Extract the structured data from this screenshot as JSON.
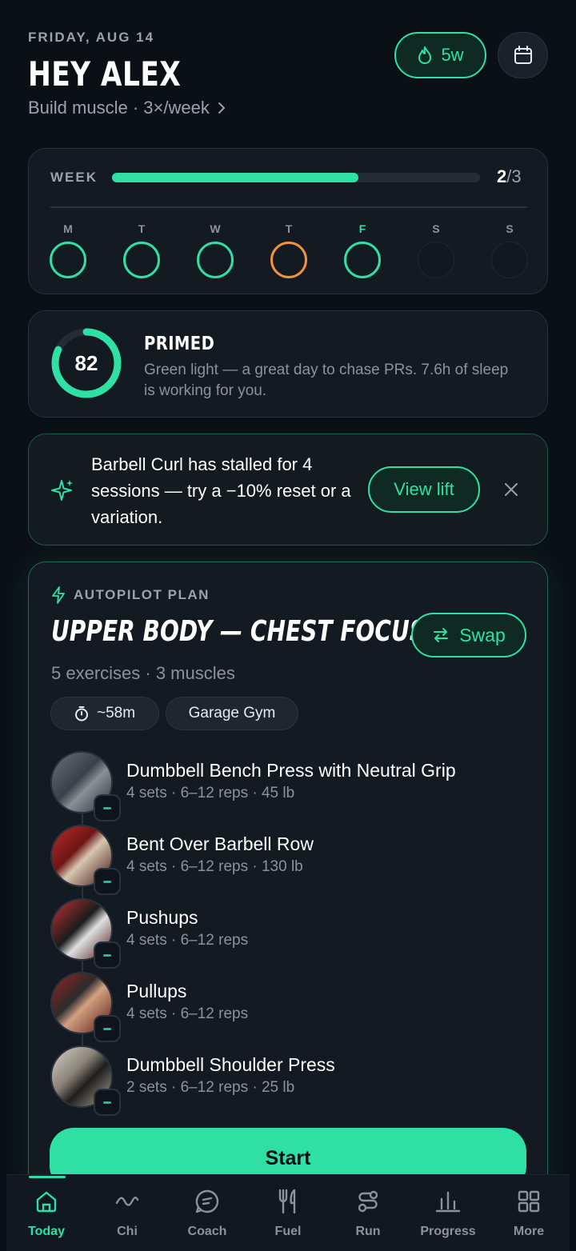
{
  "header": {
    "date": "FRIDAY, AUG 14",
    "greeting": "HEY ALEX",
    "goal": "Build muscle · 3×/week",
    "streak": "5w"
  },
  "week": {
    "label": "WEEK",
    "done": "2",
    "total": "/3",
    "progress": 0.67,
    "days": [
      {
        "letter": "M",
        "state": "done"
      },
      {
        "letter": "T",
        "state": "done"
      },
      {
        "letter": "W",
        "state": "done"
      },
      {
        "letter": "T",
        "state": "partial"
      },
      {
        "letter": "F",
        "state": "today"
      },
      {
        "letter": "S",
        "state": "empty"
      },
      {
        "letter": "S",
        "state": "empty"
      }
    ]
  },
  "readiness": {
    "score": "82",
    "score_fraction": 0.82,
    "title": "PRIMED",
    "description": "Green light — a great day to chase PRs. 7.6h of sleep is working for you."
  },
  "insight": {
    "text": "Barbell Curl has stalled for 4 sessions — try a −10% reset or a variation.",
    "button": "View lift"
  },
  "plan": {
    "label": "AUTOPILOT PLAN",
    "title": "UPPER BODY — CHEST FOCUS",
    "swap": "Swap",
    "meta": "5 exercises · 3 muscles",
    "duration": "~58m",
    "location": "Garage Gym",
    "exercises": [
      {
        "name": "Dumbbell Bench Press with Neutral Grip",
        "detail": "4 sets · 6–12 reps · 45 lb"
      },
      {
        "name": "Bent Over Barbell Row",
        "detail": "4 sets · 6–12 reps · 130 lb"
      },
      {
        "name": "Pushups",
        "detail": "4 sets · 6–12 reps"
      },
      {
        "name": "Pullups",
        "detail": "4 sets · 6–12 reps"
      },
      {
        "name": "Dumbbell Shoulder Press",
        "detail": "2 sets · 6–12 reps · 25 lb"
      }
    ],
    "start": "Start"
  },
  "nav": {
    "items": [
      {
        "label": "Today",
        "icon": "home-icon"
      },
      {
        "label": "Chi",
        "icon": "wave-icon"
      },
      {
        "label": "Coach",
        "icon": "coach-icon"
      },
      {
        "label": "Fuel",
        "icon": "fork-knife-icon"
      },
      {
        "label": "Run",
        "icon": "route-icon"
      },
      {
        "label": "Progress",
        "icon": "bar-chart-icon"
      },
      {
        "label": "More",
        "icon": "grid-icon"
      }
    ]
  },
  "colors": {
    "accent": "#2fe0a5",
    "warning": "#f2933a",
    "background": "#0b1016"
  }
}
